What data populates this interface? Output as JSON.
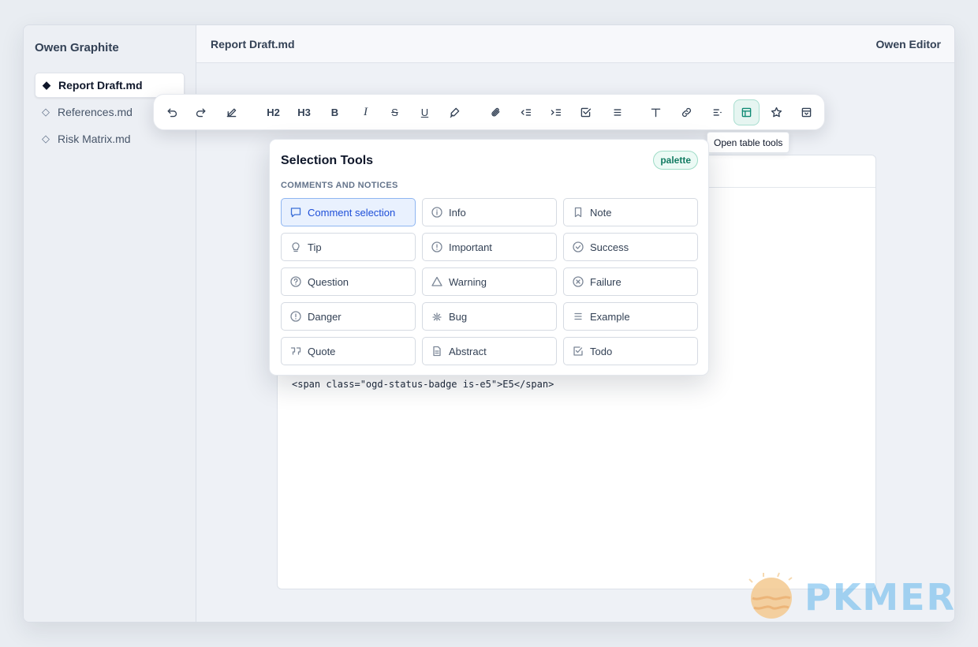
{
  "app": {
    "title": "Owen Graphite"
  },
  "sidebar": {
    "files": [
      {
        "name": "Report Draft.md",
        "active": true
      },
      {
        "name": "References.md",
        "active": false
      },
      {
        "name": "Risk Matrix.md",
        "active": false
      }
    ]
  },
  "topbar": {
    "doc_name": "Report Draft.md",
    "editor_name": "Owen Editor"
  },
  "toolbar": {
    "h2_label": "H2",
    "h3_label": "H3",
    "bold_label": "B",
    "italic_label": "I",
    "strike_label": "S",
    "underline_label": "U",
    "active_tool": "table-tools",
    "tooltip": "Open table tools"
  },
  "popover": {
    "title": "Selection Tools",
    "badge": "palette",
    "section": "COMMENTS AND NOTICES",
    "options": [
      {
        "label": "Comment selection",
        "icon": "comment-icon",
        "selected": true
      },
      {
        "label": "Info",
        "icon": "info-icon"
      },
      {
        "label": "Note",
        "icon": "bookmark-icon"
      },
      {
        "label": "Tip",
        "icon": "lightbulb-icon"
      },
      {
        "label": "Important",
        "icon": "alert-circle-icon"
      },
      {
        "label": "Success",
        "icon": "check-circle-icon"
      },
      {
        "label": "Question",
        "icon": "question-circle-icon"
      },
      {
        "label": "Warning",
        "icon": "warning-triangle-icon"
      },
      {
        "label": "Failure",
        "icon": "x-circle-icon"
      },
      {
        "label": "Danger",
        "icon": "danger-circle-icon"
      },
      {
        "label": "Bug",
        "icon": "bug-icon"
      },
      {
        "label": "Example",
        "icon": "list-icon"
      },
      {
        "label": "Quote",
        "icon": "quote-icon"
      },
      {
        "label": "Abstract",
        "icon": "document-icon"
      },
      {
        "label": "Todo",
        "icon": "checkbox-icon"
      }
    ]
  },
  "editor": {
    "code_line": "<span class=\"ogd-status-badge is-e5\">E5</span>"
  },
  "colors": {
    "accent_green": "#0f8a74",
    "selected_blue": "#1d4ed8",
    "badge_green": "#127b62"
  }
}
